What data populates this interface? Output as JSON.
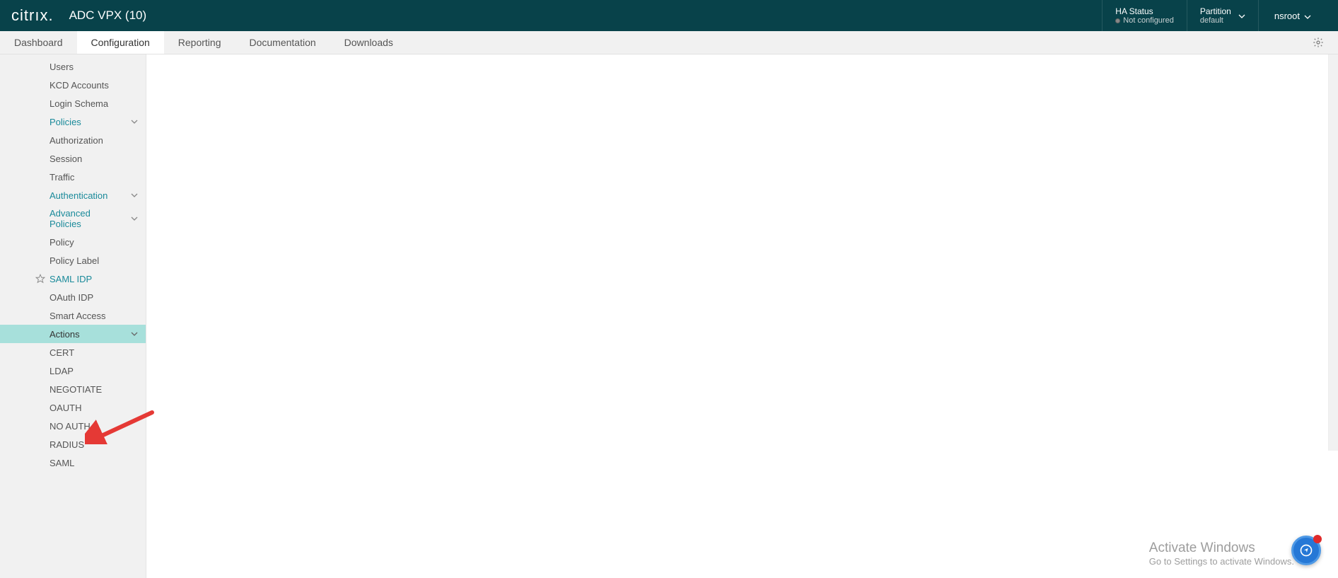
{
  "header": {
    "logo": "citrıx.",
    "product": "ADC VPX (10)",
    "ha_status_title": "HA Status",
    "ha_status_value": "Not configured",
    "partition_label": "Partition",
    "partition_value": "default",
    "user": "nsroot"
  },
  "tabs": {
    "items": [
      {
        "label": "Dashboard",
        "active": false
      },
      {
        "label": "Configuration",
        "active": true
      },
      {
        "label": "Reporting",
        "active": false
      },
      {
        "label": "Documentation",
        "active": false
      },
      {
        "label": "Downloads",
        "active": false
      }
    ]
  },
  "sidebar": {
    "items": [
      {
        "label": "Users",
        "type": "plain"
      },
      {
        "label": "KCD Accounts",
        "type": "plain"
      },
      {
        "label": "Login Schema",
        "type": "plain"
      },
      {
        "label": "Policies",
        "type": "link",
        "expandable": true
      },
      {
        "label": "Authorization",
        "type": "plain"
      },
      {
        "label": "Session",
        "type": "plain"
      },
      {
        "label": "Traffic",
        "type": "plain"
      },
      {
        "label": "Authentication",
        "type": "link",
        "expandable": true
      },
      {
        "label": "Advanced Policies",
        "type": "link",
        "expandable": true
      },
      {
        "label": "Policy",
        "type": "plain"
      },
      {
        "label": "Policy Label",
        "type": "plain"
      },
      {
        "label": "SAML IDP",
        "type": "link",
        "star": true
      },
      {
        "label": "OAuth IDP",
        "type": "plain"
      },
      {
        "label": "Smart Access",
        "type": "plain"
      },
      {
        "label": "Actions",
        "type": "plain",
        "expandable": true,
        "selected": true
      },
      {
        "label": "CERT",
        "type": "plain"
      },
      {
        "label": "LDAP",
        "type": "plain"
      },
      {
        "label": "NEGOTIATE",
        "type": "plain"
      },
      {
        "label": "OAUTH",
        "type": "plain"
      },
      {
        "label": "NO AUTH",
        "type": "plain"
      },
      {
        "label": "RADIUS",
        "type": "plain"
      },
      {
        "label": "SAML",
        "type": "plain"
      }
    ]
  },
  "watermark": {
    "line1": "Activate Windows",
    "line2": "Go to Settings to activate Windows."
  }
}
